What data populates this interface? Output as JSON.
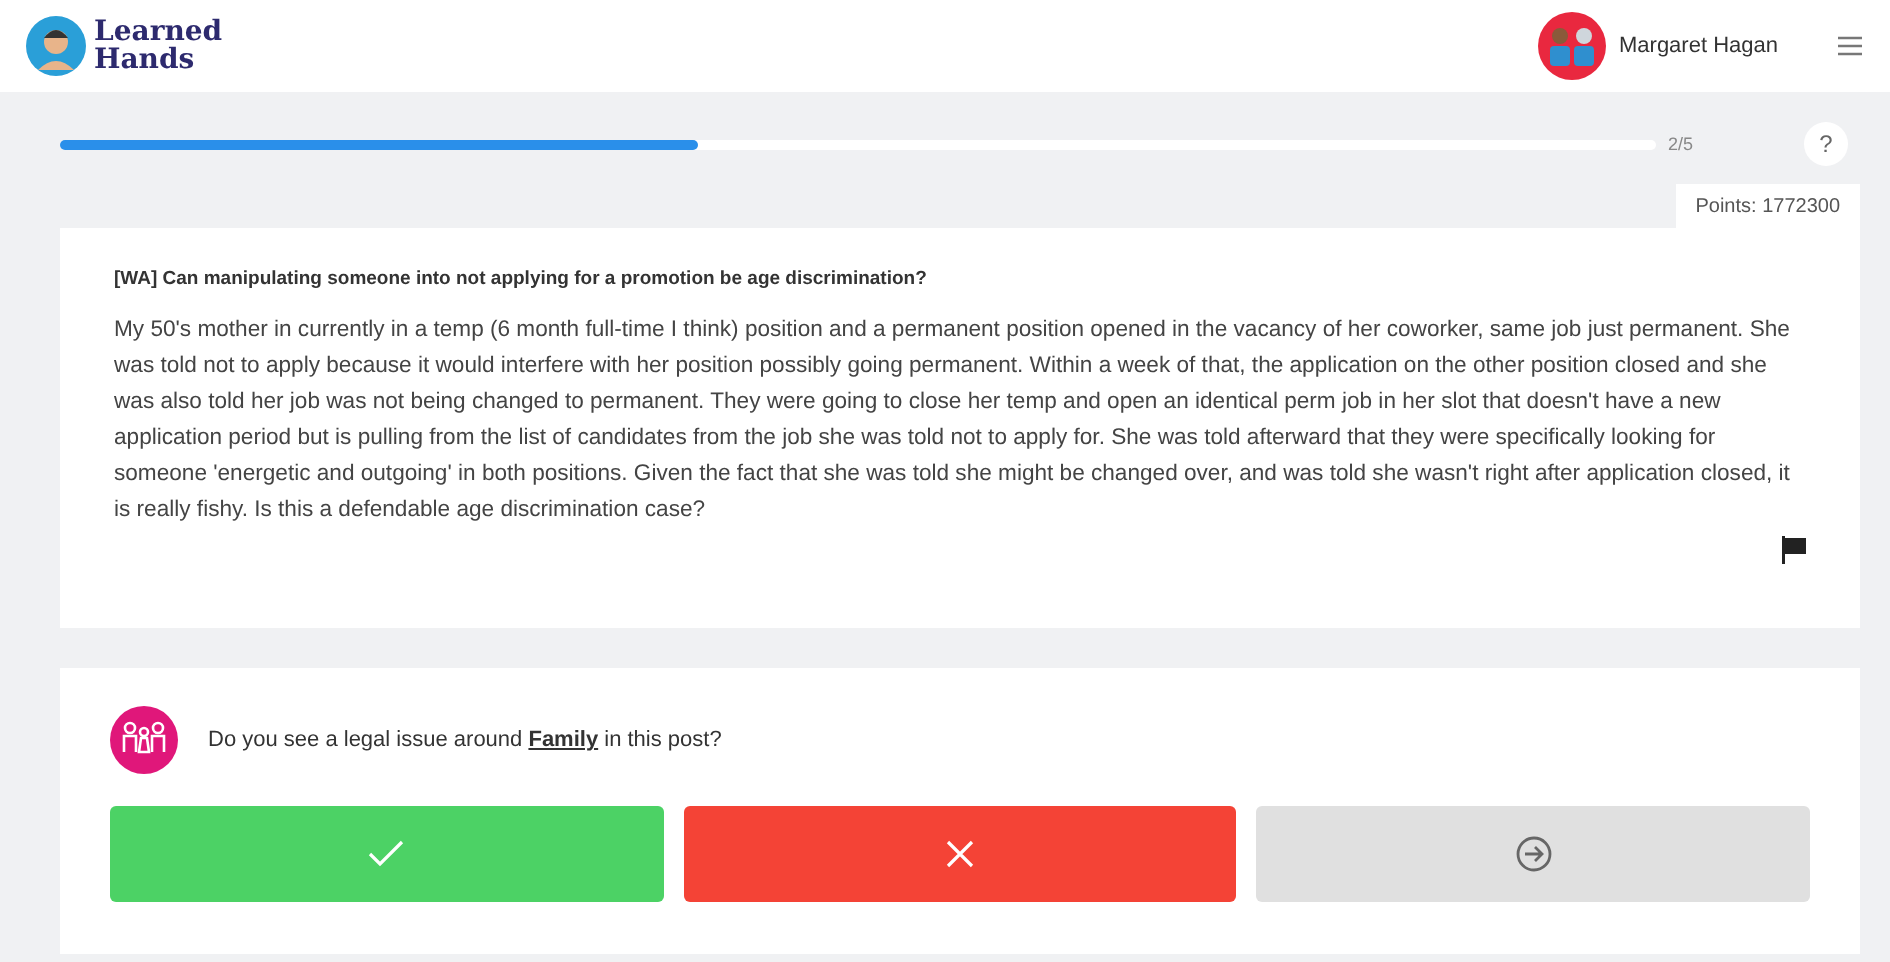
{
  "header": {
    "logo": "Learned Hands",
    "user": "Margaret Hagan"
  },
  "progress": {
    "level": 0.4,
    "label": "2/5",
    "help": "?"
  },
  "points": "Points: 1772300",
  "post": {
    "title": "[WA] Can manipulating someone into not applying for a promotion be age discrimination?",
    "body": "My 50's mother in currently in a temp (6 month full-time I think) position and a permanent position opened in the vacancy of her coworker, same job just permanent.  She was told not to apply because it would interfere with her position possibly going permanent. Within a week of that, the application on the other position closed and she was also told her job was not being changed to permanent. They were going to close her temp and open an identical perm job in her slot that doesn't have a new application period but is pulling from the list of candidates from the job she was told not to apply for. She was told afterward that they were specifically looking for someone 'energetic and outgoing' in both positions. Given the fact that she was told she might be changed over, and was told she wasn't right after application closed, it is really fishy. Is this a defendable age discrimination case?"
  },
  "question": {
    "text": "Do you see a legal issue around **Family** in this post?"
  },
  "answers": [
    {
      "kind": "yes"
    },
    {
      "kind": "no"
    },
    {
      "kind": "skip"
    }
  ]
}
